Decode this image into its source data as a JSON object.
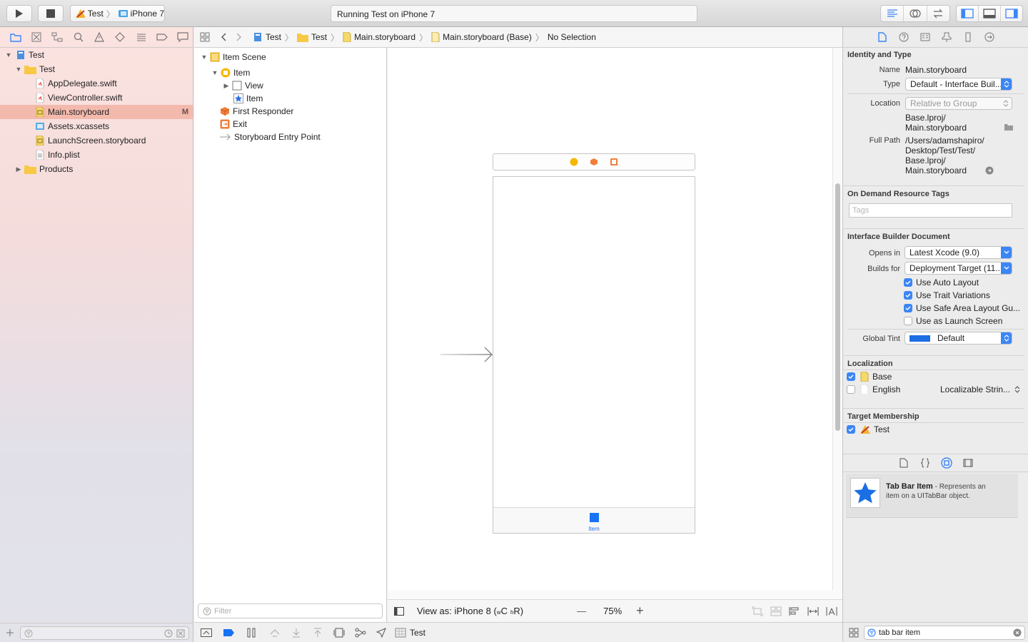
{
  "toolbar": {
    "scheme_target": "Test",
    "scheme_device": "iPhone 7",
    "activity_text": "Running Test on iPhone 7"
  },
  "navigator": {
    "tabs": [
      "folder-icon",
      "source-control-icon",
      "hierarchy-icon",
      "search-icon",
      "issue-warning-icon",
      "test-diamond-icon",
      "debug-icon",
      "breakpoint-icon",
      "report-icon"
    ],
    "tree": [
      {
        "label": "Test",
        "level": 0,
        "icon": "project-icon",
        "expanded": true
      },
      {
        "label": "Test",
        "level": 1,
        "icon": "folder-icon",
        "expanded": true
      },
      {
        "label": "AppDelegate.swift",
        "level": 2,
        "icon": "swift-file-icon"
      },
      {
        "label": "ViewController.swift",
        "level": 2,
        "icon": "swift-file-icon"
      },
      {
        "label": "Main.storyboard",
        "level": 2,
        "icon": "storyboard-icon",
        "selected": true,
        "badge": "M"
      },
      {
        "label": "Assets.xcassets",
        "level": 2,
        "icon": "assets-icon"
      },
      {
        "label": "LaunchScreen.storyboard",
        "level": 2,
        "icon": "storyboard-icon"
      },
      {
        "label": "Info.plist",
        "level": 2,
        "icon": "plist-icon"
      },
      {
        "label": "Products",
        "level": 1,
        "icon": "folder-icon",
        "expanded": false
      }
    ]
  },
  "jumpbar": {
    "crumbs": [
      "Test",
      "Test",
      "Main.storyboard",
      "Main.storyboard (Base)",
      "No Selection"
    ]
  },
  "outline": {
    "scene_label": "Item Scene",
    "rows": [
      {
        "label": "Item",
        "level": 1,
        "icon": "view-controller-icon",
        "expanded": true
      },
      {
        "label": "View",
        "level": 2,
        "icon": "view-icon",
        "expanded": false
      },
      {
        "label": "Item",
        "level": 2,
        "icon": "tab-bar-item-icon"
      },
      {
        "label": "First Responder",
        "level": 1,
        "icon": "first-responder-icon"
      },
      {
        "label": "Exit",
        "level": 1,
        "icon": "exit-icon"
      },
      {
        "label": "Storyboard Entry Point",
        "level": 1,
        "icon": "entry-arrow-icon"
      }
    ],
    "filter_placeholder": "Filter"
  },
  "canvas": {
    "tab_item_label": "Item",
    "view_as": "View as: iPhone 8 (",
    "size_class_w": "w",
    "size_class_c": "C",
    "size_class_h": "h",
    "size_class_r": "R)",
    "zoom": "75%",
    "zoom_minus": "—",
    "zoom_plus": "+"
  },
  "editor_bottom": {
    "target_label": "Test"
  },
  "inspector": {
    "tabs": [
      "file-inspector-icon",
      "quick-help-icon",
      "identity-icon",
      "attributes-icon",
      "size-icon",
      "connections-icon"
    ],
    "identity_and_type": {
      "title": "Identity and Type",
      "name_label": "Name",
      "name_value": "Main.storyboard",
      "type_label": "Type",
      "type_value": "Default - Interface Buil...",
      "location_label": "Location",
      "location_value": "Relative to Group",
      "location_path_1": "Base.lproj/",
      "location_path_2": "Main.storyboard",
      "full_path_label": "Full Path",
      "full_path_1": "/Users/adamshapiro/",
      "full_path_2": "Desktop/Test/Test/",
      "full_path_3": "Base.lproj/",
      "full_path_4": "Main.storyboard"
    },
    "on_demand": {
      "title": "On Demand Resource Tags",
      "tags_placeholder": "Tags"
    },
    "ib_document": {
      "title": "Interface Builder Document",
      "opens_in_label": "Opens in",
      "opens_in_value": "Latest Xcode (9.0)",
      "builds_for_label": "Builds for",
      "builds_for_value": "Deployment Target (11....",
      "checkboxes": [
        {
          "label": "Use Auto Layout",
          "checked": true
        },
        {
          "label": "Use Trait Variations",
          "checked": true
        },
        {
          "label": "Use Safe Area Layout Gu...",
          "checked": true
        },
        {
          "label": "Use as Launch Screen",
          "checked": false
        }
      ],
      "global_tint_label": "Global Tint",
      "global_tint_value": "Default",
      "global_tint_color": "#1d6de3"
    },
    "localization": {
      "title": "Localization",
      "rows": [
        {
          "label": "Base",
          "checked": true,
          "extra": ""
        },
        {
          "label": "English",
          "checked": false,
          "extra": "Localizable Strin..."
        }
      ]
    },
    "target_membership": {
      "title": "Target Membership",
      "target": "Test",
      "checked": true
    },
    "library": {
      "tabs": [
        "file-template-icon",
        "code-snippet-icon",
        "object-library-icon",
        "media-library-icon"
      ],
      "item_title": "Tab Bar Item",
      "item_desc_1": " - Represents an",
      "item_desc_2": "item on a UITabBar object.",
      "search_value": "tab bar item"
    }
  },
  "colors": {
    "accent": "#3b86f7",
    "selection": "#f4b9ad",
    "tab_item_blue": "#1673f4"
  }
}
